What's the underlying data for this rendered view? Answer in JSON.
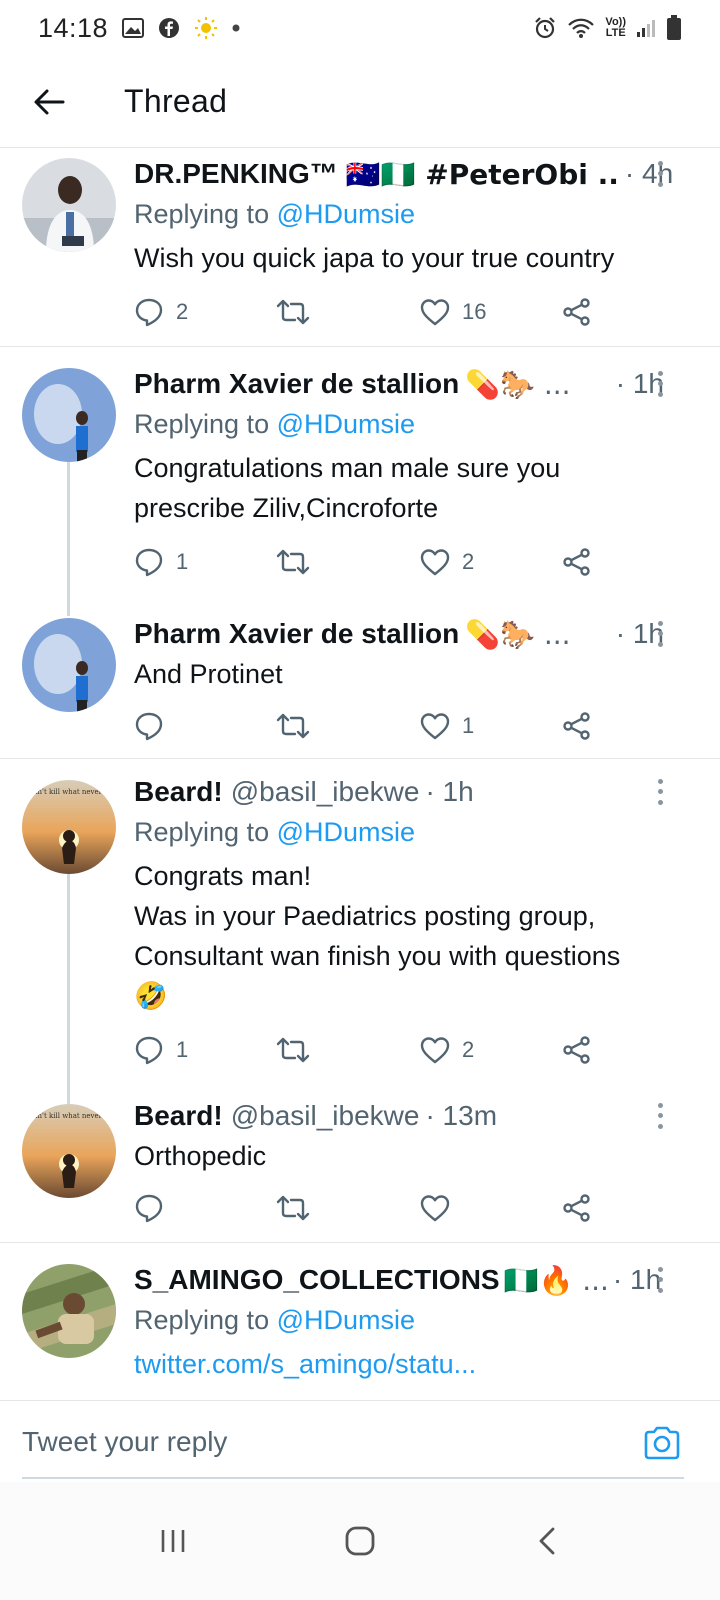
{
  "status_bar": {
    "time": "14:18",
    "left_icons": [
      "gallery-icon",
      "facebook-icon",
      "sun-icon",
      "dot-icon"
    ],
    "right_icons": [
      "alarm-icon",
      "wifi-icon",
      "volte-icon",
      "signal-icon",
      "battery-icon"
    ],
    "volte_text_top": "Vo))",
    "volte_text_bottom": "LTE"
  },
  "header": {
    "title": "Thread",
    "back_icon": "arrow-left-icon"
  },
  "tweets": [
    {
      "name": "DR.PENKING™",
      "name_suffix": "🇦🇺🇳🇬 #PeterObi ..",
      "handle": "",
      "time": "· 4h",
      "replying_prefix": "Replying to ",
      "replying_to": "@HDumsie",
      "text": "Wish you quick japa to your true country",
      "replies": "2",
      "retweets": "",
      "likes": "16"
    },
    {
      "name": "Pharm Xavier de stallion",
      "name_suffix": "💊🐎 ...",
      "handle": "",
      "time": "· 1h",
      "replying_prefix": "Replying to ",
      "replying_to": "@HDumsie",
      "text": "Congratulations man male sure you\nprescribe Ziliv,Cincroforte",
      "replies": "1",
      "retweets": "",
      "likes": "2"
    },
    {
      "name": "Pharm Xavier de stallion",
      "name_suffix": "💊🐎 ...",
      "handle": "",
      "time": "· 1h",
      "text": "And Protinet",
      "replies": "",
      "retweets": "",
      "likes": "1"
    },
    {
      "name": "Beard!",
      "name_suffix": "",
      "handle": "@basil_ibekwe",
      "time": "· 1h",
      "replying_prefix": "Replying to ",
      "replying_to": "@HDumsie",
      "text": "Congrats man!\nWas in your Paediatrics posting group,\nConsultant wan finish you with questions\n🤣",
      "replies": "1",
      "retweets": "",
      "likes": "2"
    },
    {
      "name": "Beard!",
      "name_suffix": "",
      "handle": "@basil_ibekwe",
      "time": "· 13m",
      "text": "Orthopedic",
      "replies": "",
      "retweets": "",
      "likes": ""
    },
    {
      "name": "S_AMINGO_COLLECTIONS",
      "name_suffix": "🇳🇬🔥 ...",
      "handle": "",
      "time": "· 1h",
      "replying_prefix": "Replying to ",
      "replying_to": "@HDumsie",
      "link": "twitter.com/s_amingo/statu..."
    }
  ],
  "avatar_text": "You can't kill what never lived.",
  "reply_bar": {
    "placeholder": "Tweet your reply",
    "camera_icon": "camera-icon"
  },
  "nav_bar": {
    "icons": [
      "recent-apps-icon",
      "home-icon",
      "back-icon"
    ]
  },
  "colors": {
    "accent": "#1d9bf0",
    "secondary_text": "#536471",
    "divider": "#e6e6e6"
  }
}
